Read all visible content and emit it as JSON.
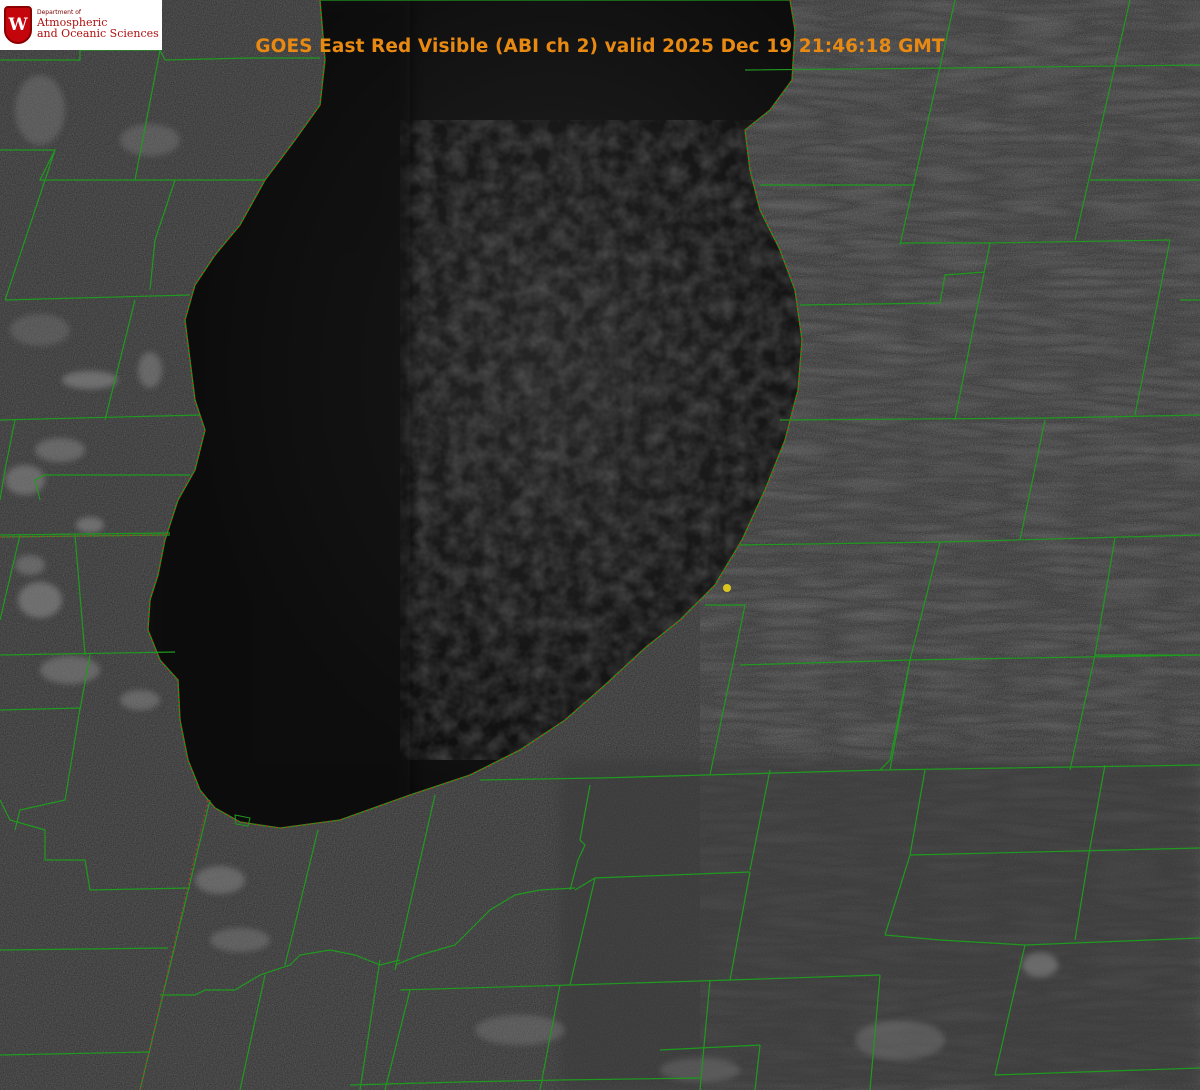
{
  "header": {
    "title": "GOES East Red Visible (ABI ch 2) valid 2025 Dec 19 21:46:18 GMT"
  },
  "logo": {
    "seal_letter": "W",
    "department_line": "Department of",
    "name_line1": "Atmospheric",
    "name_line2": "and Oceanic Sciences"
  },
  "colors": {
    "title": "#e88a12",
    "county_lines": "#1f9a1f",
    "shoreline_dots": "#d42020",
    "point_marker": "#d9c51e",
    "lake": "#0e0e0e",
    "land": "#2a2a2a"
  },
  "image": {
    "satellite": "GOES East",
    "product": "Red Visible (ABI ch 2)",
    "feature": "lake",
    "marker_icon": "yellow-dot-icon"
  }
}
